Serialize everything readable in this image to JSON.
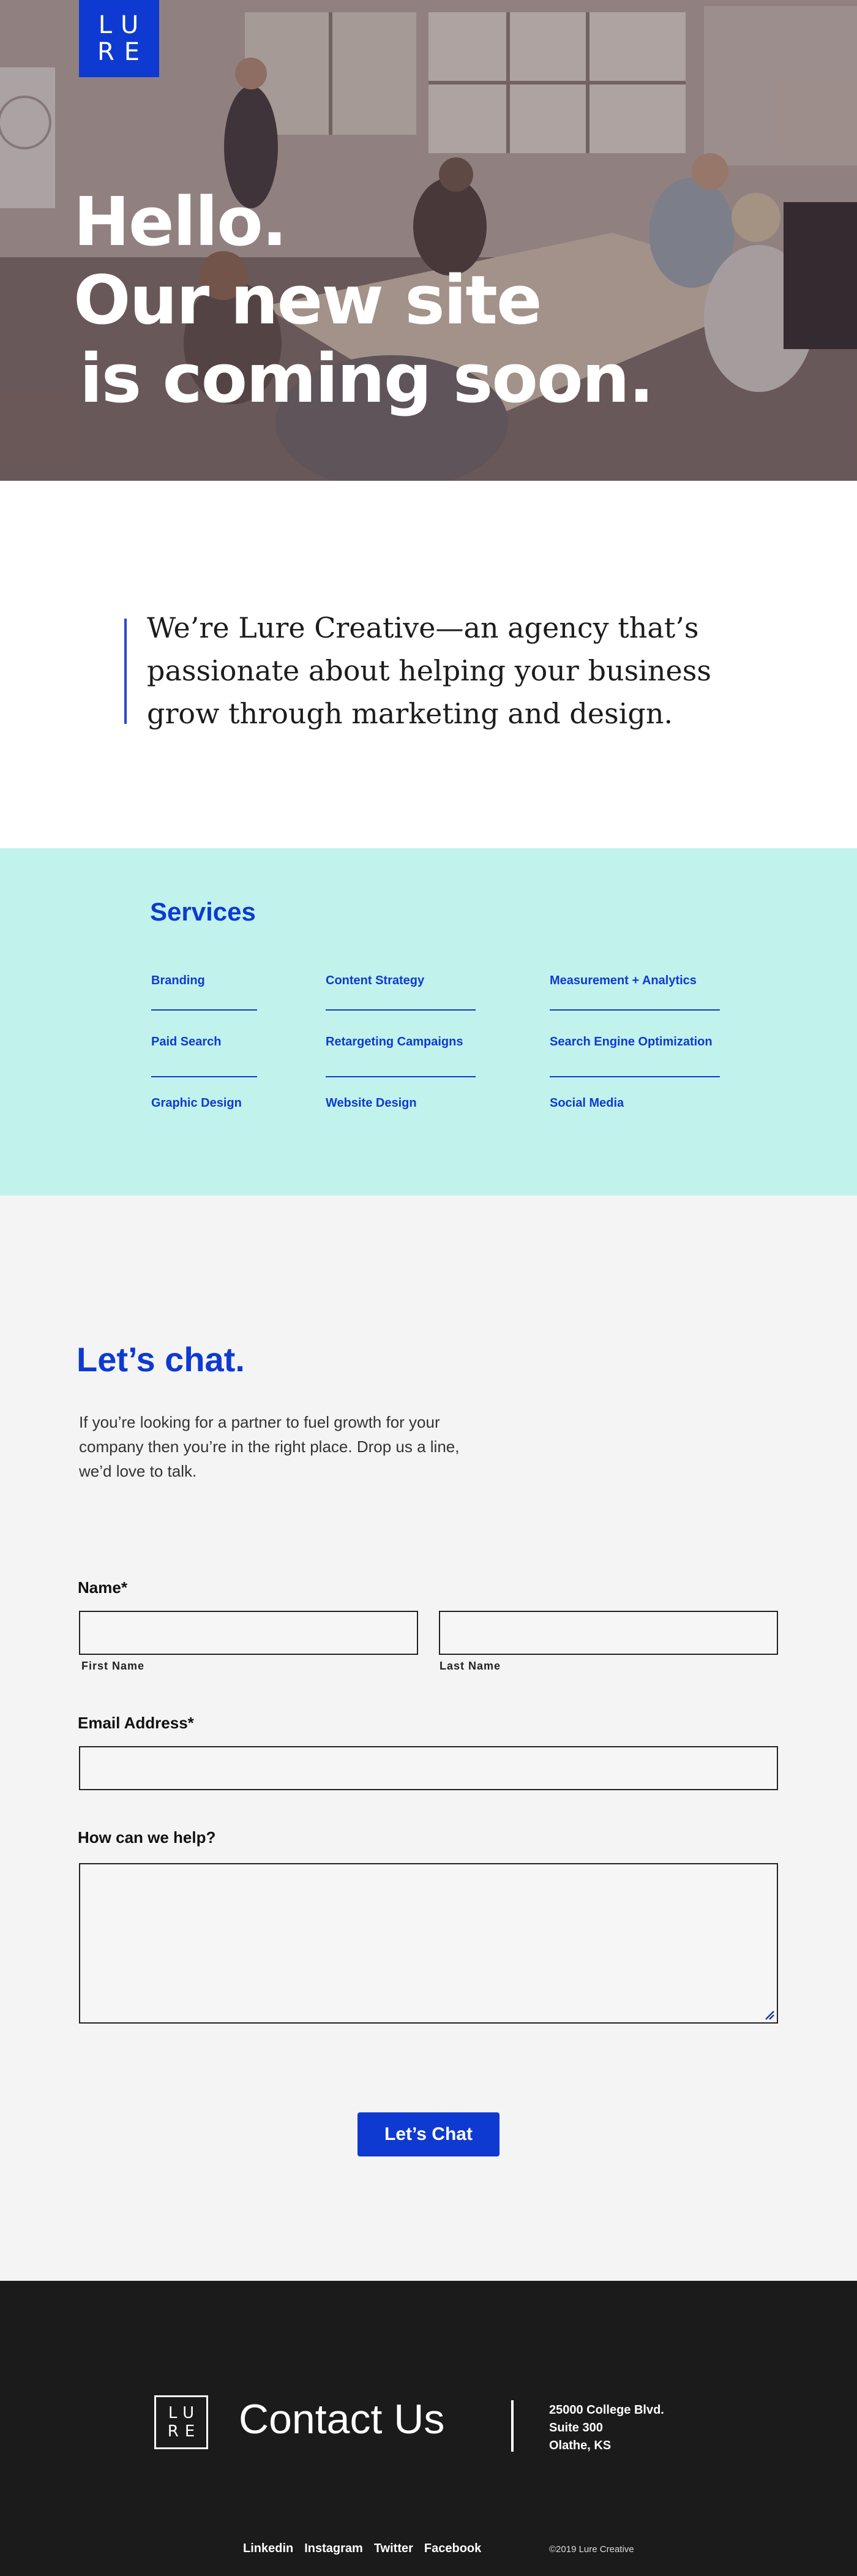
{
  "hero": {
    "logo_line1": "LU",
    "logo_line2": "RE",
    "title_line1": "Hello.",
    "title_line2": "Our new site",
    "title_line3": "is coming soon."
  },
  "intro": {
    "text": "We’re Lure Creative—an agency that’s passionate about helping your business grow through marketing and design."
  },
  "services": {
    "title": "Services",
    "items": [
      "Branding",
      "Content Strategy",
      "Measurement + Analytics",
      "Paid Search",
      "Retargeting Campaigns",
      "Search Engine Optimization",
      "Graphic Design",
      "Website Design",
      "Social Media"
    ]
  },
  "chat": {
    "title": "Let’s chat.",
    "description": "If you’re looking for a partner to fuel growth for your company then you’re in the right place. Drop us a line, we’d love to talk.",
    "name_label": "Name*",
    "first_name_label": "First Name",
    "last_name_label": "Last Name",
    "email_label": "Email Address*",
    "help_label": "How can we help?",
    "first_name_value": "",
    "last_name_value": "",
    "email_value": "",
    "help_value": "",
    "submit_label": "Let’s Chat"
  },
  "footer": {
    "logo_line1": "LU",
    "logo_line2": "RE",
    "contact_title": "Contact Us",
    "address_line1": "25000 College Blvd.",
    "address_line2": "Suite 300",
    "address_line3": "Olathe, KS",
    "links": [
      "Linkedin",
      "Instagram",
      "Twitter",
      "Facebook"
    ],
    "copyright": "©2019 Lure Creative"
  },
  "colors": {
    "accent": "#0e3ad1",
    "services_bg": "#c1f2ec",
    "form_bg": "#f4f4f4",
    "footer_bg": "#1b1b1b"
  }
}
